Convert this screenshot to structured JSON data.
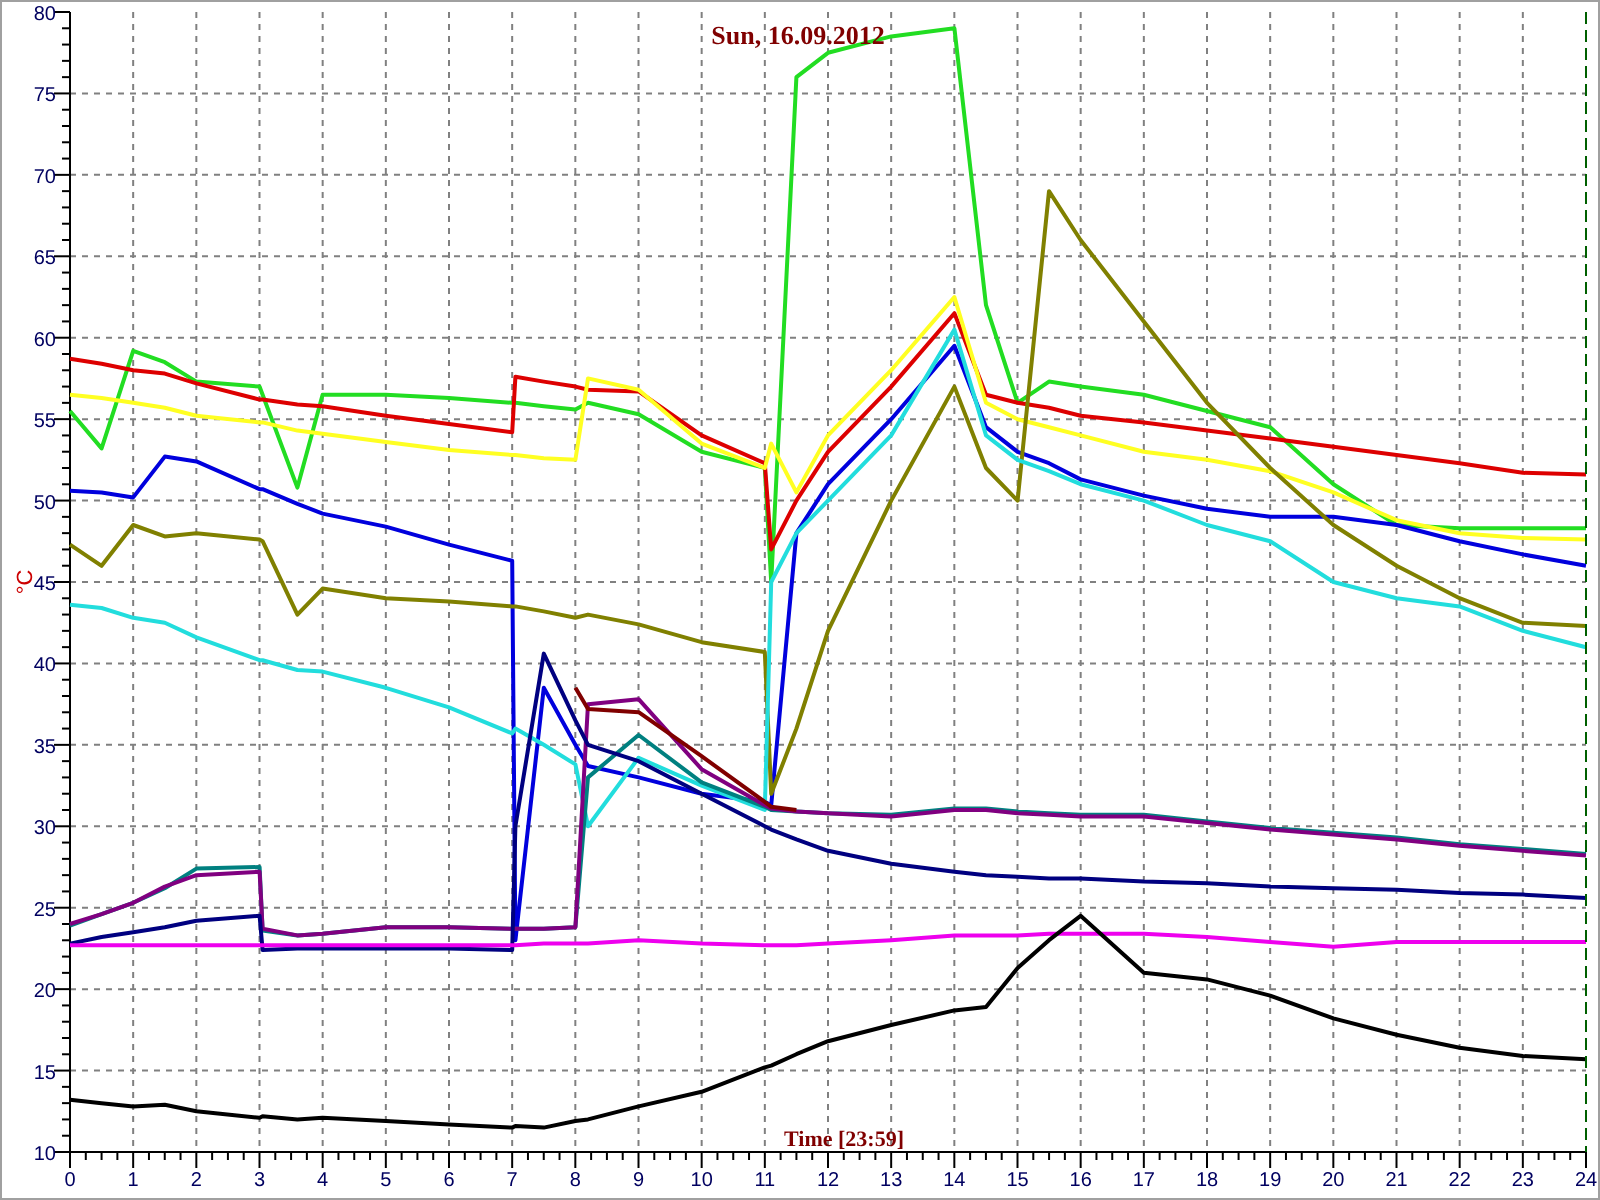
{
  "chart": {
    "chart_data": {
      "type": "line",
      "title": "Sun, 16.09.2012",
      "xlabel": "Time [23:59]",
      "ylabel": "°C",
      "grid": true,
      "xlim": [
        0,
        24
      ],
      "ylim": [
        10,
        80
      ],
      "xticks": [
        0,
        1,
        2,
        3,
        4,
        5,
        6,
        7,
        8,
        9,
        10,
        11,
        12,
        13,
        14,
        15,
        16,
        17,
        18,
        19,
        20,
        21,
        22,
        23,
        24
      ],
      "yticks": [
        10,
        15,
        20,
        25,
        30,
        35,
        40,
        45,
        50,
        55,
        60,
        65,
        70,
        75,
        80
      ],
      "x": [
        0,
        0.5,
        1,
        1.5,
        2,
        3,
        3.05,
        3.6,
        4,
        5,
        6,
        7,
        7.05,
        7.5,
        8,
        8.2,
        9,
        10,
        11,
        11.1,
        11.5,
        12,
        13,
        14,
        14.5,
        15,
        15.5,
        16,
        17,
        18,
        19,
        20,
        21,
        22,
        23,
        24
      ],
      "series": [
        {
          "color": "#22dd22",
          "values": [
            55.5,
            53.2,
            59.2,
            58.5,
            57.3,
            57,
            56.5,
            50.8,
            56.5,
            56.5,
            56.3,
            56,
            56,
            55.8,
            55.6,
            56,
            55.3,
            53,
            52,
            45,
            76,
            77.5,
            78.5,
            79,
            62,
            56,
            57.3,
            57,
            56.5,
            55.5,
            54.5,
            51,
            48.5,
            48.3,
            48.3,
            48.3
          ]
        },
        {
          "color": "#dd0000",
          "values": [
            58.7,
            58.4,
            58,
            57.8,
            57.2,
            56.2,
            56.2,
            55.9,
            55.8,
            55.2,
            54.7,
            54.2,
            57.6,
            57.3,
            57,
            56.8,
            56.7,
            54,
            52.3,
            47,
            50,
            53,
            57,
            61.5,
            56.5,
            56,
            55.7,
            55.2,
            54.8,
            54.3,
            53.8,
            53.3,
            52.8,
            52.3,
            51.7,
            51.6
          ]
        },
        {
          "color": "#ffff22",
          "values": [
            56.5,
            56.3,
            56,
            55.7,
            55.2,
            54.8,
            54.8,
            54.3,
            54.1,
            53.6,
            53.1,
            52.8,
            52.8,
            52.6,
            52.5,
            57.5,
            56.8,
            53.5,
            52,
            53.5,
            50.5,
            54,
            58,
            62.5,
            56,
            55,
            54.5,
            54,
            53,
            52.5,
            51.8,
            50.5,
            48.8,
            48,
            47.7,
            47.6
          ]
        },
        {
          "color": "#0000dd",
          "values": [
            50.6,
            50.5,
            50.2,
            52.7,
            52.4,
            50.7,
            50.7,
            49.8,
            49.2,
            48.4,
            47.3,
            46.3,
            23,
            38.5,
            35,
            33.7,
            33,
            32,
            31.5,
            31.3,
            48,
            51,
            55,
            59.5,
            54.5,
            53,
            52.3,
            51.3,
            50.3,
            49.5,
            49,
            49,
            48.5,
            47.5,
            46.7,
            46
          ]
        },
        {
          "color": "#808000",
          "values": [
            47.3,
            46,
            48.5,
            47.8,
            48,
            47.6,
            47.5,
            43,
            44.6,
            44,
            43.8,
            43.5,
            43.5,
            43.2,
            42.8,
            43,
            42.4,
            41.3,
            40.7,
            32,
            36,
            42,
            50,
            57,
            52,
            50,
            69,
            66,
            61,
            56,
            52,
            48.5,
            46,
            44,
            42.5,
            42.3
          ]
        },
        {
          "color": "#22dddd",
          "values": [
            43.6,
            43.4,
            42.8,
            42.5,
            41.6,
            40.2,
            40.2,
            39.6,
            39.5,
            38.5,
            37.3,
            35.7,
            36,
            35,
            33.8,
            30,
            34.2,
            32.5,
            31,
            45,
            48,
            50,
            54,
            60.5,
            54,
            52.5,
            51.8,
            51,
            50,
            48.5,
            47.5,
            45,
            44,
            43.5,
            42,
            41
          ]
        },
        {
          "color": "#008080",
          "values": [
            23.9,
            24.6,
            25.3,
            26.2,
            27.4,
            27.5,
            23.6,
            23.3,
            23.4,
            23.8,
            23.8,
            23.7,
            23.7,
            23.7,
            23.8,
            33,
            35.6,
            32.7,
            31.2,
            31,
            30.9,
            30.8,
            30.7,
            31.1,
            31.1,
            30.9,
            30.8,
            30.7,
            30.7,
            30.3,
            29.9,
            29.6,
            29.3,
            28.9,
            28.6,
            28.3
          ]
        },
        {
          "color": "#800080",
          "values": [
            24,
            24.6,
            25.3,
            26.3,
            27,
            27.2,
            23.7,
            23.3,
            23.4,
            23.8,
            23.8,
            23.7,
            23.7,
            23.7,
            23.8,
            37.5,
            37.8,
            33.5,
            31.3,
            31.1,
            30.9,
            30.8,
            30.6,
            31,
            31,
            30.8,
            30.7,
            30.6,
            30.6,
            30.2,
            29.8,
            29.5,
            29.2,
            28.8,
            28.5,
            28.2
          ]
        },
        {
          "color": "#800000",
          "values": [
            null,
            null,
            null,
            null,
            null,
            null,
            null,
            null,
            null,
            null,
            null,
            null,
            null,
            null,
            38.5,
            37.2,
            37,
            34.3,
            31.5,
            31.2,
            31,
            null,
            null,
            null,
            null,
            null,
            null,
            null,
            null,
            null,
            null,
            null,
            null,
            null,
            null,
            null
          ]
        },
        {
          "color": "#000080",
          "values": [
            22.8,
            23.2,
            23.5,
            23.8,
            24.2,
            24.5,
            22.4,
            22.5,
            22.5,
            22.5,
            22.5,
            22.4,
            30,
            40.6,
            36.5,
            35,
            34,
            32,
            30,
            29.8,
            29.2,
            28.5,
            27.7,
            27.2,
            27,
            26.9,
            26.8,
            26.8,
            26.6,
            26.5,
            26.3,
            26.2,
            26.1,
            25.9,
            25.8,
            25.6
          ]
        },
        {
          "color": "#ee00ee",
          "values": [
            22.7,
            22.7,
            22.7,
            22.7,
            22.7,
            22.7,
            22.7,
            22.7,
            22.7,
            22.7,
            22.7,
            22.7,
            22.7,
            22.8,
            22.8,
            22.8,
            23,
            22.8,
            22.7,
            22.7,
            22.7,
            22.8,
            23,
            23.3,
            23.3,
            23.3,
            23.4,
            23.4,
            23.4,
            23.2,
            22.9,
            22.6,
            22.9,
            22.9,
            22.9,
            22.9
          ]
        },
        {
          "color": "#000000",
          "values": [
            13.2,
            13,
            12.8,
            12.9,
            12.5,
            12.1,
            12.2,
            12,
            12.1,
            11.9,
            11.7,
            11.5,
            11.6,
            11.5,
            11.9,
            12,
            12.8,
            13.7,
            15.2,
            15.3,
            16,
            16.8,
            17.8,
            18.7,
            18.9,
            21.3,
            23,
            24.5,
            21,
            20.6,
            19.6,
            18.2,
            17.2,
            16.4,
            15.9,
            15.7
          ]
        }
      ]
    }
  }
}
